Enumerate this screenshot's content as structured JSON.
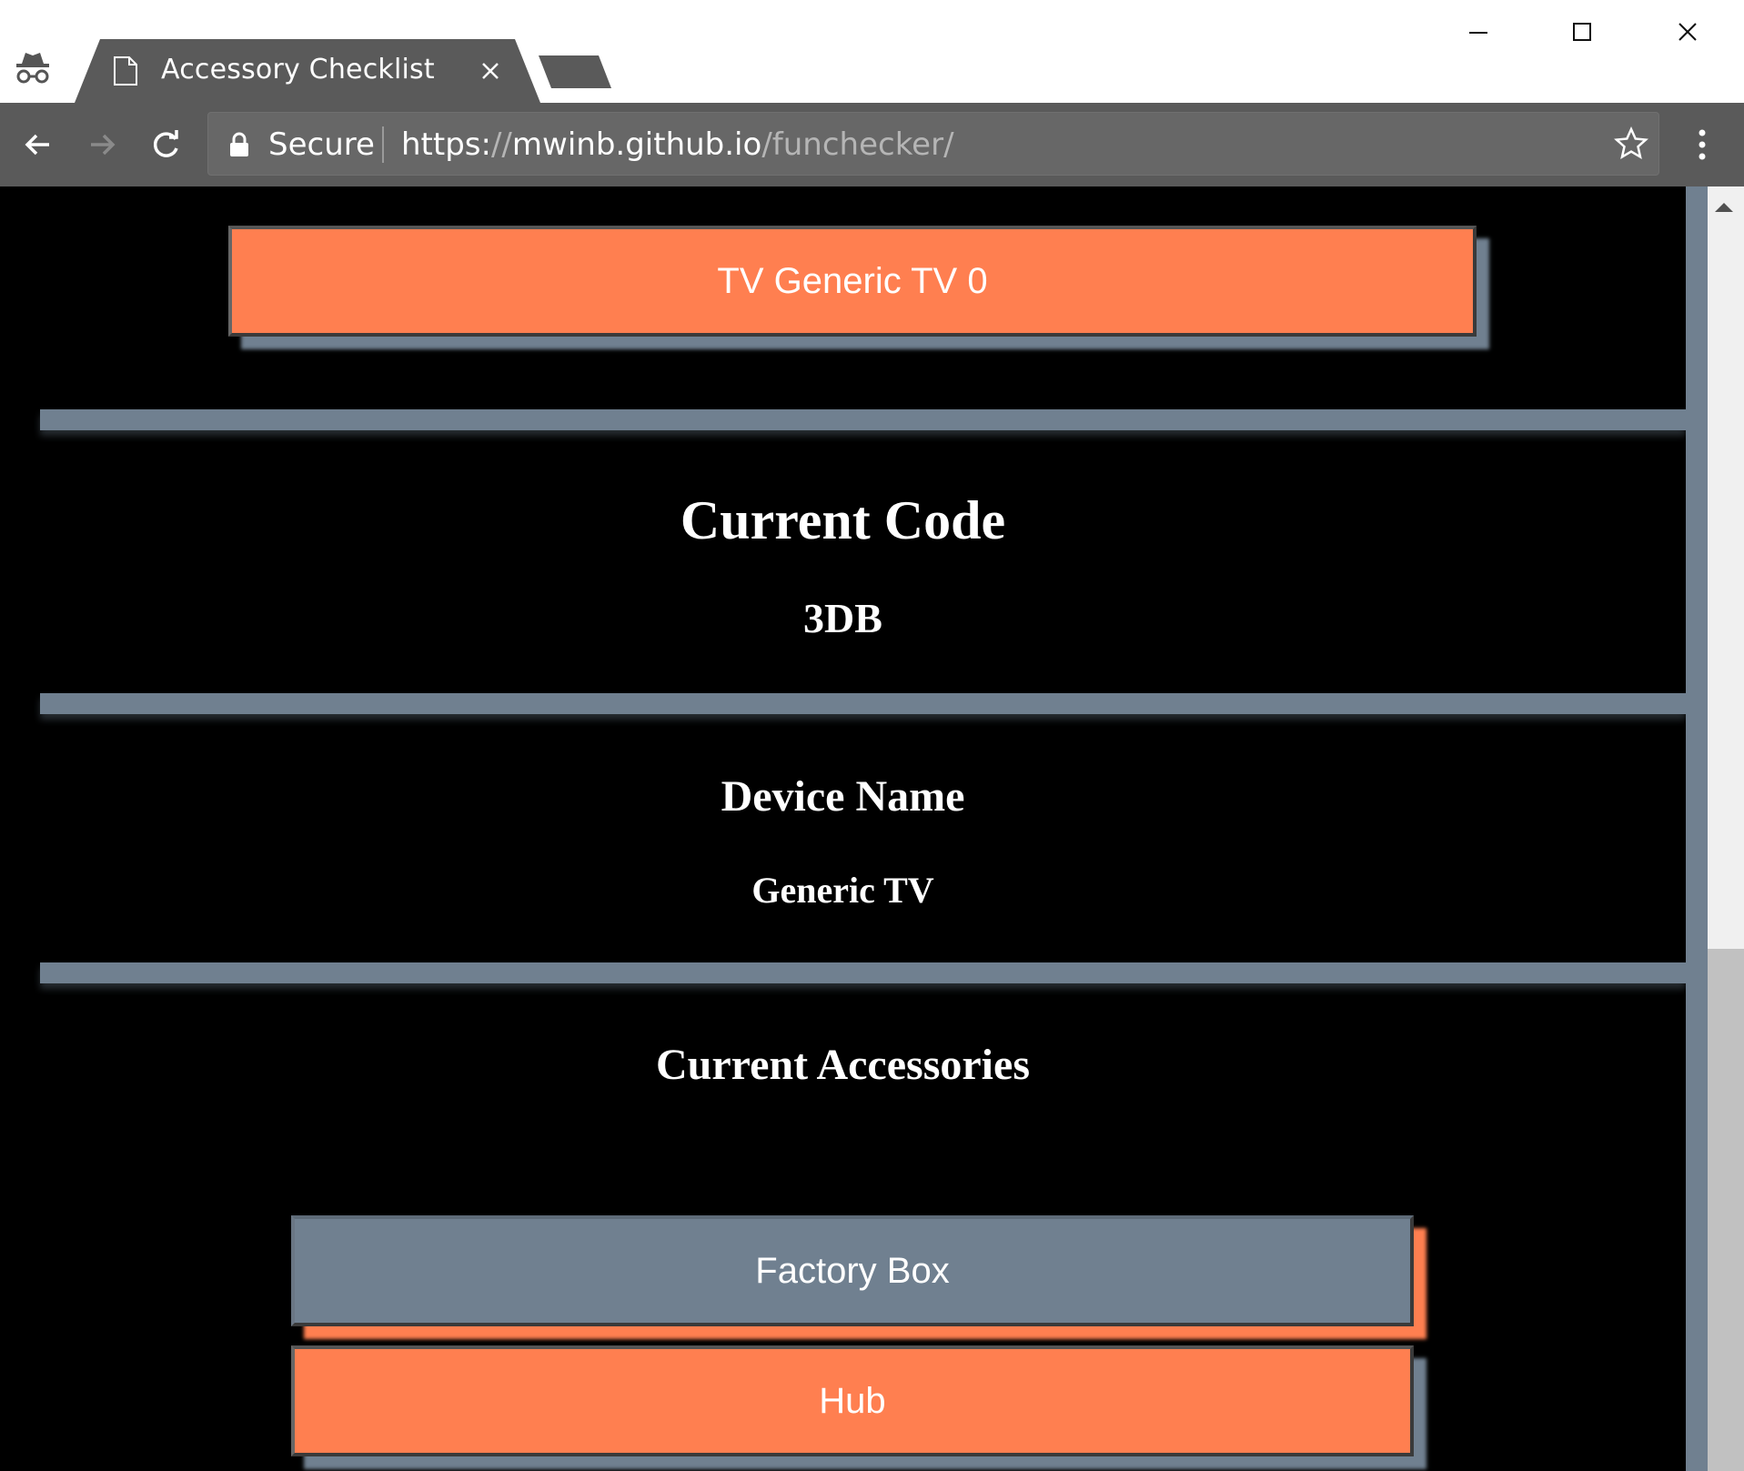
{
  "browser": {
    "tab_title": "Accessory Checklist",
    "secure_label": "Secure",
    "url_scheme": "https:",
    "url_slashes": "//",
    "url_host": "mwinb.github.io",
    "url_path": "/funchecker/"
  },
  "page": {
    "tv_button": "TV Generic TV 0",
    "current_code_heading": "Current Code",
    "current_code_value": "3DB",
    "device_name_heading": "Device Name",
    "device_name_value": "Generic TV",
    "accessories_heading": "Current Accessories",
    "accessories": [
      {
        "label": "Factory Box",
        "color": "#708090"
      },
      {
        "label": "Hub",
        "color": "#ff7f50"
      }
    ]
  },
  "colors": {
    "accent_orange": "#ff7f50",
    "slate": "#708090",
    "background": "#000000"
  },
  "icons": [
    "incognito-icon",
    "file-icon",
    "close-icon",
    "minimize-icon",
    "maximize-icon",
    "window-close-icon",
    "back-arrow-icon",
    "forward-arrow-icon",
    "reload-icon",
    "lock-icon",
    "star-icon",
    "menu-icon",
    "scroll-up-icon"
  ]
}
